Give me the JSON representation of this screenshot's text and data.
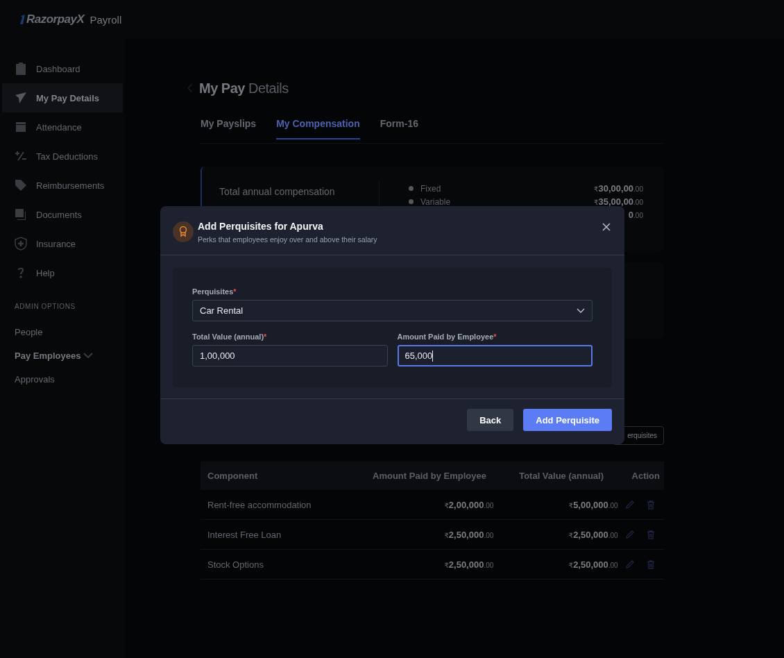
{
  "header": {
    "logo": "RazorpayX",
    "product": "Payroll"
  },
  "sidebar": {
    "items": [
      {
        "label": "Dashboard",
        "selected": false
      },
      {
        "label": "My Pay Details",
        "selected": true
      },
      {
        "label": "Attendance",
        "selected": false
      },
      {
        "label": "Tax Deductions",
        "selected": false
      },
      {
        "label": "Reimbursements",
        "selected": false
      },
      {
        "label": "Documents",
        "selected": false
      },
      {
        "label": "Insurance",
        "selected": false
      },
      {
        "label": "Help",
        "selected": false
      }
    ],
    "section_title": "ADMIN OPTIONS",
    "admin_items": [
      {
        "label": "People",
        "expandable": false,
        "bold": false
      },
      {
        "label": "Pay Employees",
        "expandable": true,
        "bold": true
      },
      {
        "label": "Approvals",
        "expandable": false,
        "bold": false
      }
    ]
  },
  "page": {
    "title_bold": "My Pay",
    "title_rest": "Details",
    "tabs": [
      {
        "label": "My Payslips",
        "selected": false
      },
      {
        "label": "My Compensation",
        "selected": true
      },
      {
        "label": "Form-16",
        "selected": false
      }
    ],
    "summary": {
      "label": "Total annual compensation",
      "rows": [
        {
          "label": "Fixed",
          "currency": "₹",
          "amount": "30,00,00",
          "decimals": ".00"
        },
        {
          "label": "Variable",
          "currency": "₹",
          "amount": "35,00,00",
          "decimals": ".00"
        },
        {
          "label": "",
          "currency": "",
          "amount": "0",
          "decimals": ".00"
        }
      ]
    },
    "perquisites_button": "erquisites",
    "table": {
      "columns": [
        "Component",
        "Amount Paid by Employee",
        "Total Value (annual)",
        "Action"
      ],
      "rows": [
        {
          "component": "Rent-free accommodation",
          "paid": {
            "currency": "₹",
            "amount": "2,00,000",
            "decimals": ".00"
          },
          "total": {
            "currency": "₹",
            "amount": "5,00,000",
            "decimals": ".00"
          }
        },
        {
          "component": "Interest Free Loan",
          "paid": {
            "currency": "₹",
            "amount": "2,50,000",
            "decimals": ".00"
          },
          "total": {
            "currency": "₹",
            "amount": "2,50,000",
            "decimals": ".00"
          }
        },
        {
          "component": "Stock Options",
          "paid": {
            "currency": "₹",
            "amount": "2,50,000",
            "decimals": ".00"
          },
          "total": {
            "currency": "₹",
            "amount": "2,50,000",
            "decimals": ".00"
          }
        }
      ]
    }
  },
  "modal": {
    "title": "Add Perquisites for Apurva",
    "subtitle": "Perks that employees enjoy over and above their salary",
    "fields": [
      {
        "kind": "select",
        "label": "Perquisites",
        "required_mark": "*",
        "value": "Car Rental",
        "focused": false
      },
      {
        "kind": "text",
        "label": "Total Value (annual)",
        "required_mark": "*",
        "value": "1,00,000",
        "focused": false
      },
      {
        "kind": "text",
        "label": "Amount Paid by Employee",
        "required_mark": "*",
        "value": "65,000",
        "focused": true
      }
    ],
    "buttons": [
      {
        "label": "Back",
        "kind": "secondary"
      },
      {
        "label": "Add Perquisite",
        "kind": "primary"
      }
    ]
  }
}
